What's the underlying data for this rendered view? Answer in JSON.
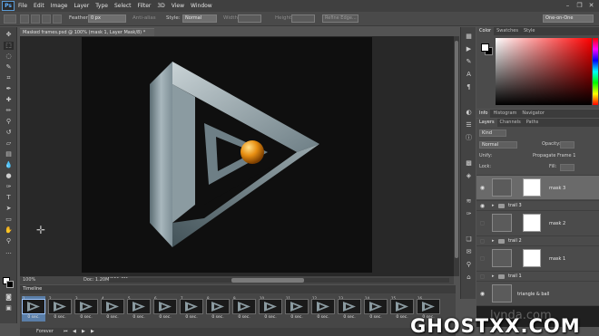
{
  "app": {
    "logo": "Ps"
  },
  "menubar": {
    "items": [
      "File",
      "Edit",
      "Image",
      "Layer",
      "Type",
      "Select",
      "Filter",
      "3D",
      "View",
      "Window"
    ]
  },
  "options": {
    "feather_label": "Feather:",
    "feather_value": "0 px",
    "antialias_label": "Anti-alias",
    "style_label": "Style:",
    "style_value": "Normal",
    "width_label": "Width:",
    "height_label": "Height:",
    "refine_label": "Refine Edge...",
    "workspace": "One-on-One"
  },
  "document": {
    "tab_title": "Masked frames.psd @ 100% (mask 1, Layer Mask/8) *",
    "zoom": "100%",
    "doc_size": "Doc: 1.20M/151.0M"
  },
  "color_panel": {
    "tabs": [
      "Color",
      "Swatches",
      "Style"
    ]
  },
  "info_panel": {
    "tabs": [
      "Info",
      "Histogram",
      "Navigator"
    ]
  },
  "layers_panel": {
    "tabs": [
      "Layers",
      "Channels",
      "Paths"
    ],
    "kind_filter": "Kind",
    "blend_mode": "Normal",
    "opacity_label": "Opacity:",
    "unify_label": "Unify:",
    "propagate_label": "Propagate Frame 1",
    "lock_label": "Lock:",
    "fill_label": "Fill:",
    "layers": [
      {
        "name": "mask 3",
        "type": "layer-with-mask",
        "visible": true,
        "selected": true
      },
      {
        "name": "trail 3",
        "type": "group",
        "visible": true
      },
      {
        "name": "mask 2",
        "type": "layer-with-mask",
        "visible": false
      },
      {
        "name": "trail 2",
        "type": "group",
        "visible": false
      },
      {
        "name": "mask 1",
        "type": "layer-with-mask",
        "visible": false
      },
      {
        "name": "trail 1",
        "type": "group",
        "visible": false
      },
      {
        "name": "triangle & ball",
        "type": "layer",
        "visible": true
      }
    ]
  },
  "timeline": {
    "title": "Timeline",
    "frames": [
      {
        "n": "1",
        "delay": "0 sec."
      },
      {
        "n": "2",
        "delay": "0 sec."
      },
      {
        "n": "3",
        "delay": "0 sec."
      },
      {
        "n": "4",
        "delay": "0 sec."
      },
      {
        "n": "5",
        "delay": "0 sec."
      },
      {
        "n": "6",
        "delay": "0 sec."
      },
      {
        "n": "7",
        "delay": "0 sec."
      },
      {
        "n": "8",
        "delay": "0 sec."
      },
      {
        "n": "9",
        "delay": "0 sec."
      },
      {
        "n": "10",
        "delay": "0 sec."
      },
      {
        "n": "11",
        "delay": "0 sec."
      },
      {
        "n": "12",
        "delay": "0 sec."
      },
      {
        "n": "13",
        "delay": "0 sec."
      },
      {
        "n": "14",
        "delay": "0 sec."
      },
      {
        "n": "15",
        "delay": "0 sec."
      },
      {
        "n": "16",
        "delay": "0 sec."
      }
    ],
    "loop": "Forever"
  },
  "watermark": {
    "text": "GHOSTXX.COM",
    "faint": "lynda.com"
  },
  "colors": {
    "accent": "#5fb0ff",
    "ball": "#e08a12",
    "canvas_bg": "#0f0f0f"
  }
}
